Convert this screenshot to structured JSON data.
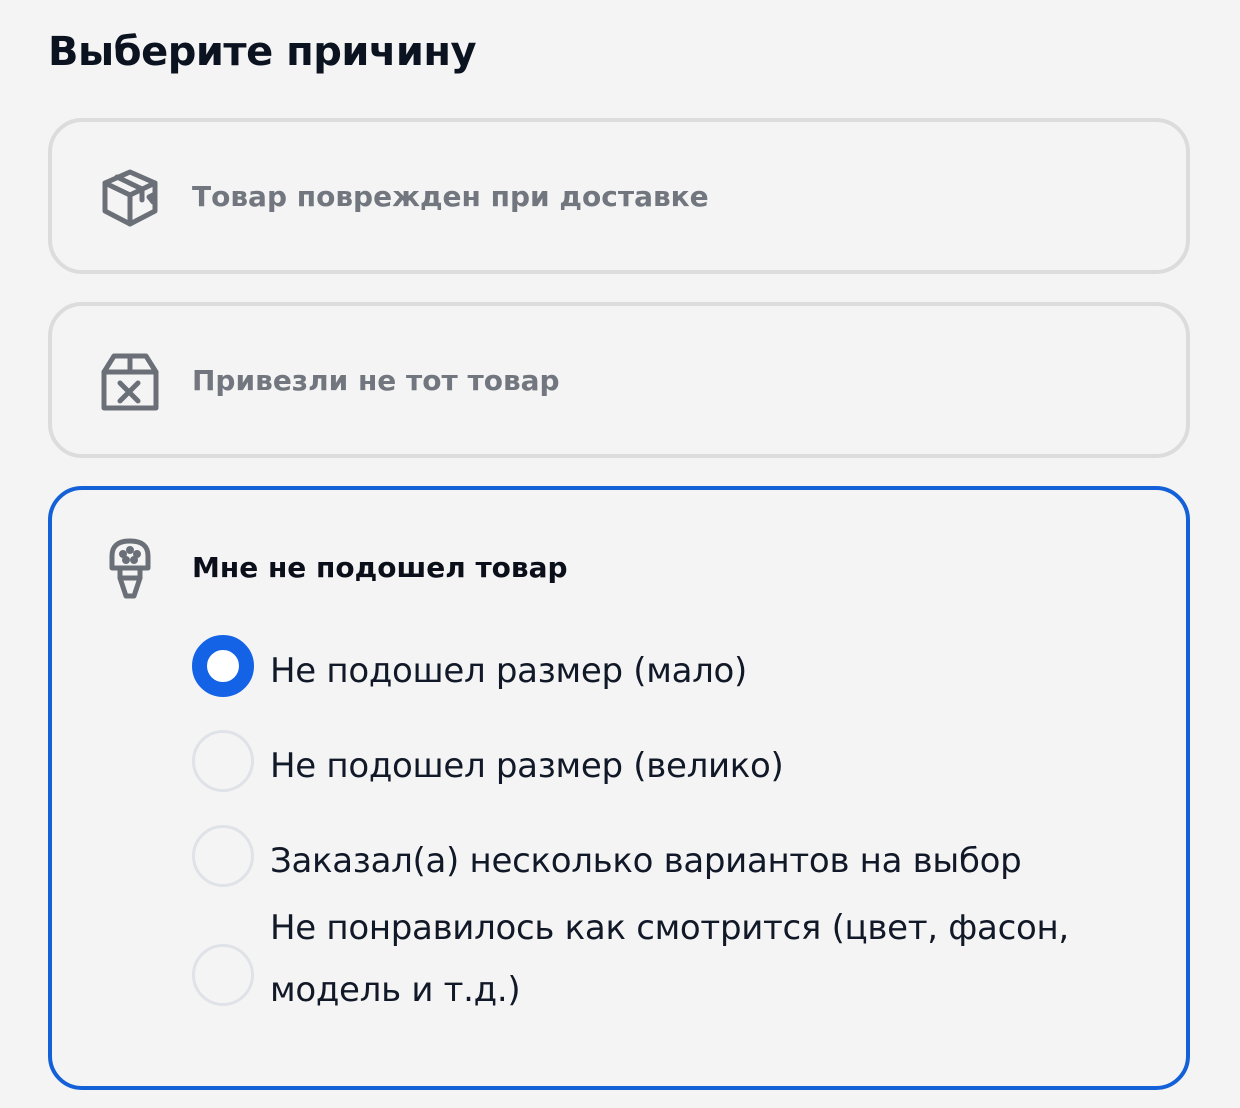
{
  "page": {
    "title": "Выберите причину"
  },
  "reasons": [
    {
      "label": "Товар поврежден при доставке",
      "icon": "damaged-box-icon",
      "selected": false
    },
    {
      "label": "Привезли не тот товар",
      "icon": "wrong-box-icon",
      "selected": false
    },
    {
      "label": "Мне не подошел товар",
      "icon": "plug-icon",
      "selected": true,
      "options": [
        {
          "label": "Не подошел размер (мало)",
          "checked": true
        },
        {
          "label": "Не подошел размер (велико)",
          "checked": false
        },
        {
          "label": "Заказал(а) несколько вариантов на выбор",
          "checked": false
        },
        {
          "label": "Не понравилось как смотрится (цвет, фасон, модель и т.д.)",
          "checked": false
        }
      ]
    }
  ],
  "colors": {
    "accent": "#1463e6",
    "card_border": "#dcdcdc",
    "selected_border": "#1460d8",
    "muted_text": "#72767e",
    "background": "#f4f4f4"
  }
}
